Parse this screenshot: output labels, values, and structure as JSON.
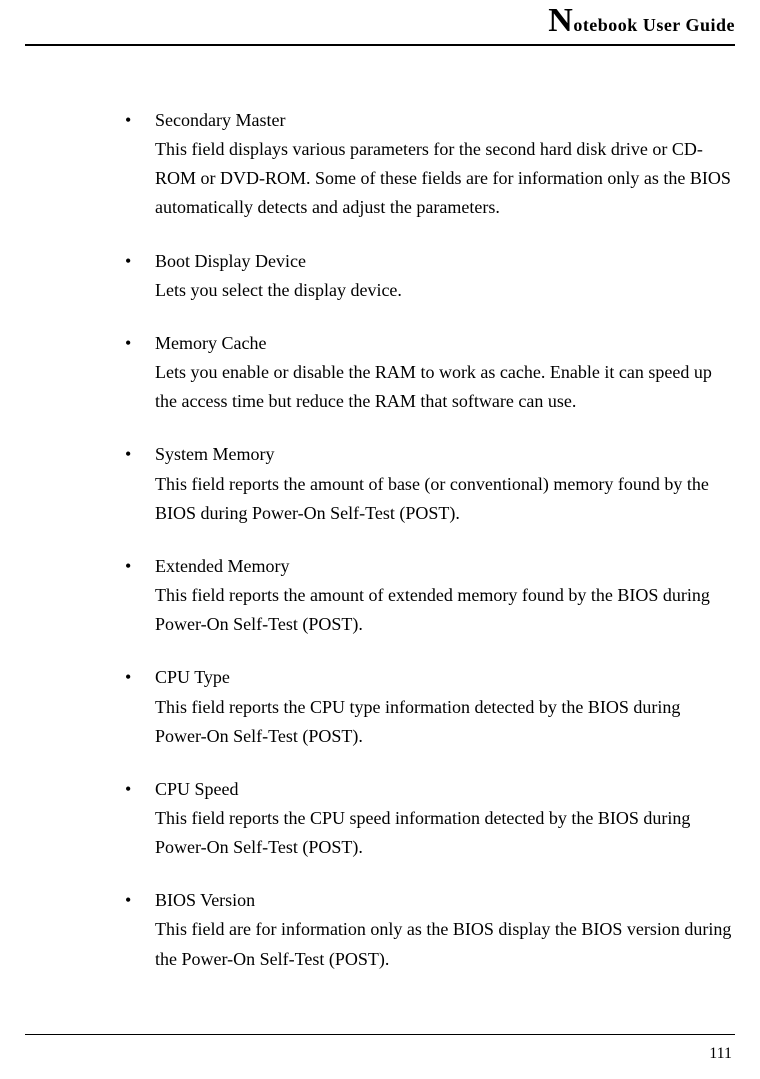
{
  "header": {
    "big_letter": "N",
    "title_rest": "otebook User Guide"
  },
  "items": [
    {
      "title": "Secondary Master",
      "desc": "This field displays various parameters for the second hard disk drive or CD-ROM or DVD-ROM. Some of these fields are for information only as the BIOS automatically detects and adjust the parameters."
    },
    {
      "title": "Boot Display Device",
      "desc": "Lets you select the display device."
    },
    {
      "title": "Memory Cache",
      "desc": "Lets you enable or disable the RAM to work as cache. Enable it can speed up the access time but reduce the RAM that software can use."
    },
    {
      "title": "System Memory",
      "desc": "This field reports the amount of base (or conventional) memory found by the BIOS during Power-On Self-Test (POST)."
    },
    {
      "title": "Extended Memory",
      "desc": "This field reports the amount of extended memory found by the BIOS during Power-On Self-Test (POST)."
    },
    {
      "title": "CPU Type",
      "desc": "This field reports the CPU type information detected by the BIOS during Power-On Self-Test (POST)."
    },
    {
      "title": "CPU Speed",
      "desc": "This field reports the CPU speed information detected by the BIOS during Power-On Self-Test (POST)."
    },
    {
      "title": "BIOS Version",
      "desc": "This field are for information only as the BIOS display the BIOS version during the Power-On Self-Test (POST)."
    }
  ],
  "page_number": "111"
}
